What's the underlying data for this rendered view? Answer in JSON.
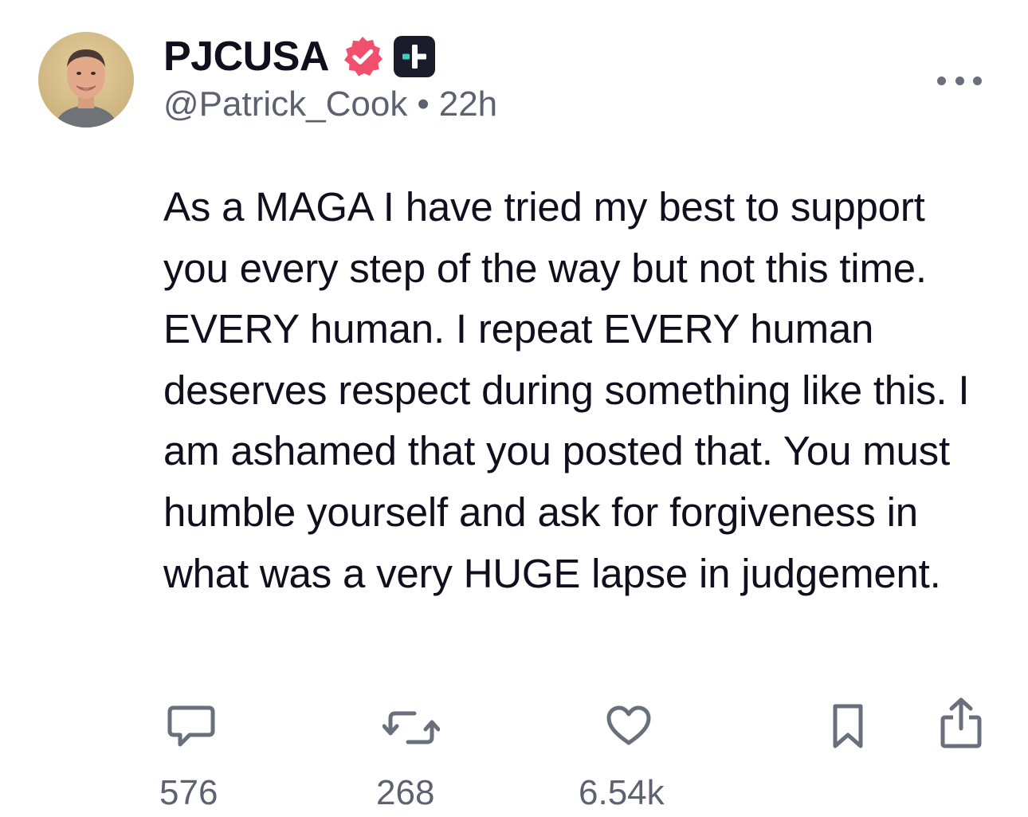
{
  "author": {
    "display_name": "PJCUSA",
    "handle": "@Patrick_Cook",
    "time_ago": "22h",
    "separator": "•",
    "verified_color": "#f0506e",
    "avatar_icon": "user-photo"
  },
  "post": {
    "text": "As a MAGA I have tried my best to support you every step of the way but not this time. EVERY human. I repeat EVERY human deserves respect during something like this. I am ashamed that you posted that. You must humble yourself and ask for forgiveness in what was a very HUGE lapse in judgement."
  },
  "actions": {
    "reply": {
      "icon": "comment-icon",
      "count": "576"
    },
    "repost": {
      "icon": "repost-icon",
      "count": "268"
    },
    "like": {
      "icon": "heart-icon",
      "count": "6.54k"
    },
    "bookmark": {
      "icon": "bookmark-icon"
    },
    "share": {
      "icon": "share-icon"
    }
  },
  "colors": {
    "text": "#0f0f1e",
    "muted": "#5d6271",
    "icon": "#6a6f7d",
    "plus_accent": "#3ad0c0"
  }
}
